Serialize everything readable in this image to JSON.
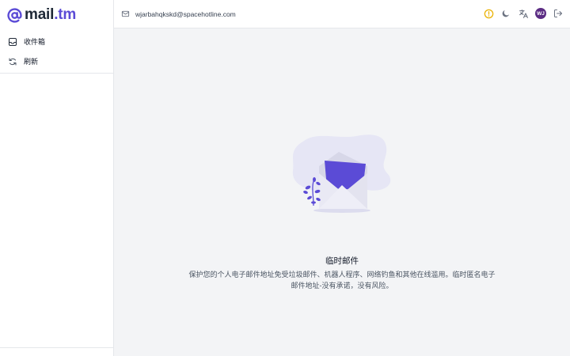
{
  "brand": {
    "mail": "mail",
    "tm": ".tm",
    "accent": "#5b4bd6"
  },
  "sidebar": {
    "items": [
      {
        "label": "收件箱",
        "icon": "inbox-icon"
      },
      {
        "label": "刷新",
        "icon": "refresh-icon"
      }
    ]
  },
  "topbar": {
    "email": "wjarbahqkskd@spacehotline.com",
    "avatar_initials": "WJ",
    "icons": [
      "warning-icon",
      "moon-icon",
      "translate-icon",
      "avatar",
      "logout-icon"
    ],
    "warning_color": "#eab308"
  },
  "empty_state": {
    "title": "临时邮件",
    "description": "保护您的个人电子邮件地址免受垃圾邮件、机器人程序、网络钓鱼和其他在线滥用。临时匿名电子邮件地址-没有承诺，没有风险。"
  }
}
